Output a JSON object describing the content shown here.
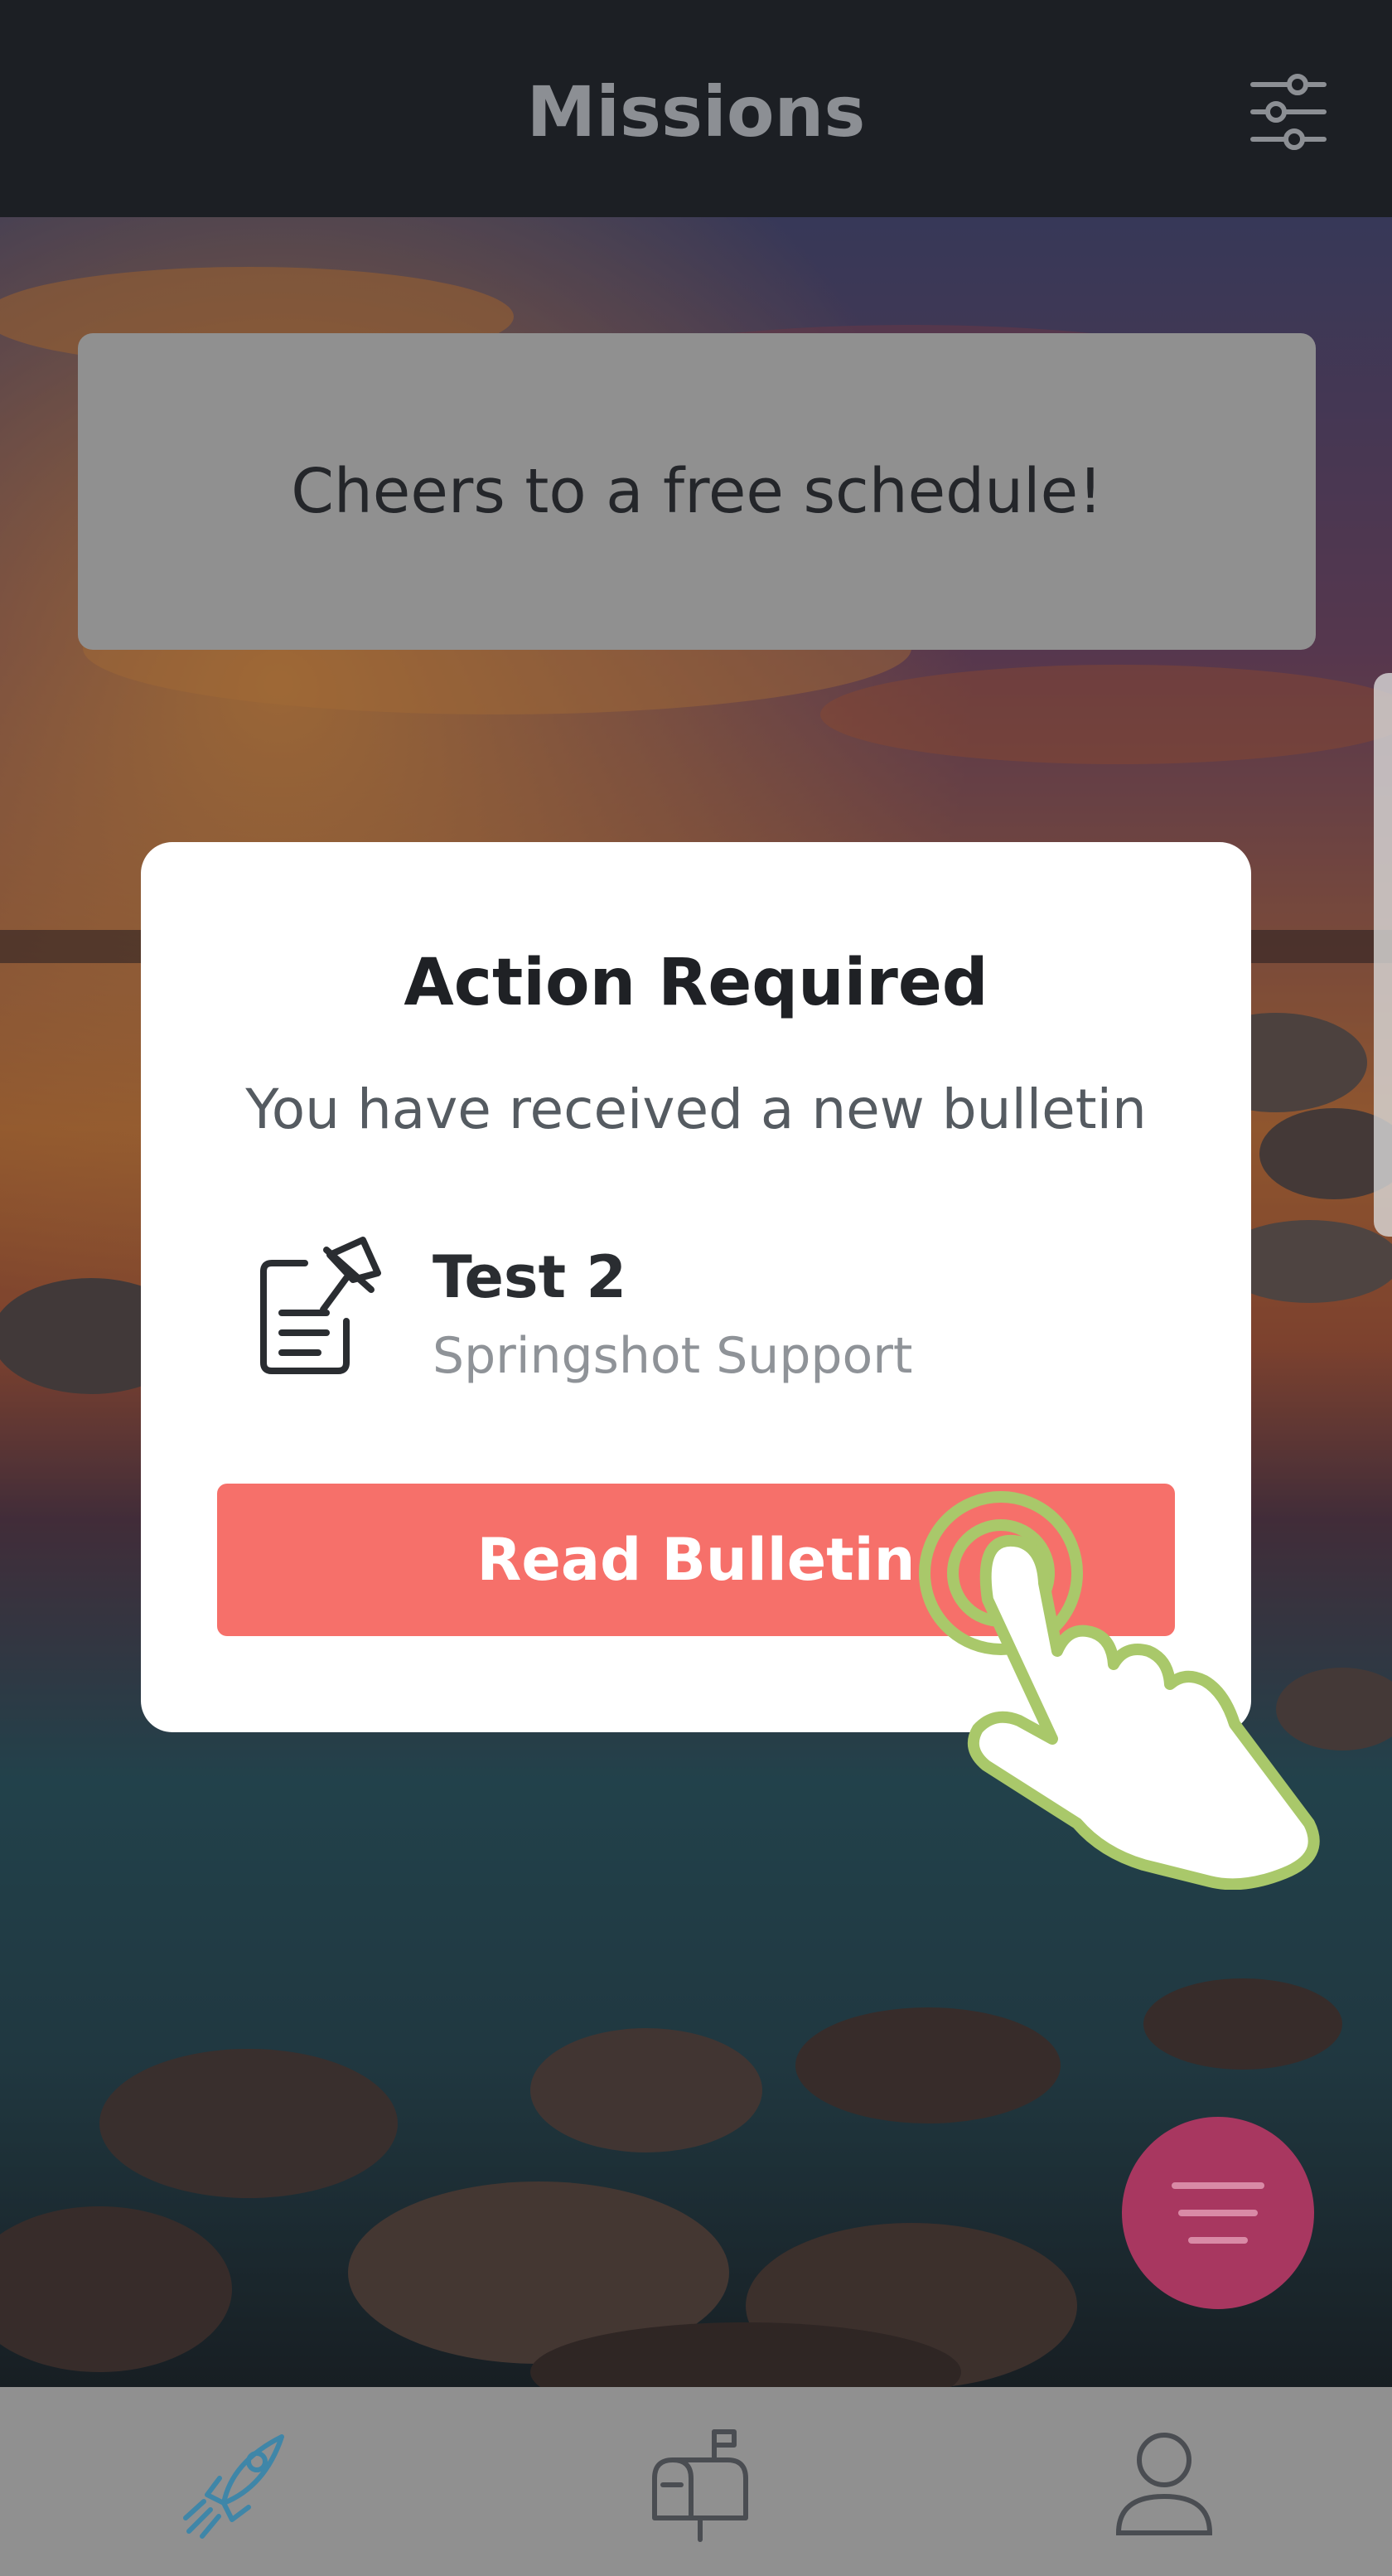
{
  "header": {
    "title": "Missions",
    "filter_icon": "sliders-icon"
  },
  "banner": {
    "text": "Cheers to a free schedule!"
  },
  "modal": {
    "title": "Action Required",
    "subtitle": "You have received a new bulletin",
    "bulletin": {
      "icon": "bulletin-pin-icon",
      "name": "Test 2",
      "sender": "Springshot Support"
    },
    "button_label": "Read Bulletin"
  },
  "fab": {
    "icon": "menu-lines-icon",
    "color": "#a83760"
  },
  "bottom_nav": {
    "items": [
      {
        "icon": "rocket-icon",
        "active": true
      },
      {
        "icon": "mailbox-icon",
        "active": false
      },
      {
        "icon": "profile-icon",
        "active": false
      }
    ]
  },
  "colors": {
    "accent_button": "#f6706a",
    "tap_hint": "#a9c86a",
    "active_nav": "#3f86a8"
  }
}
